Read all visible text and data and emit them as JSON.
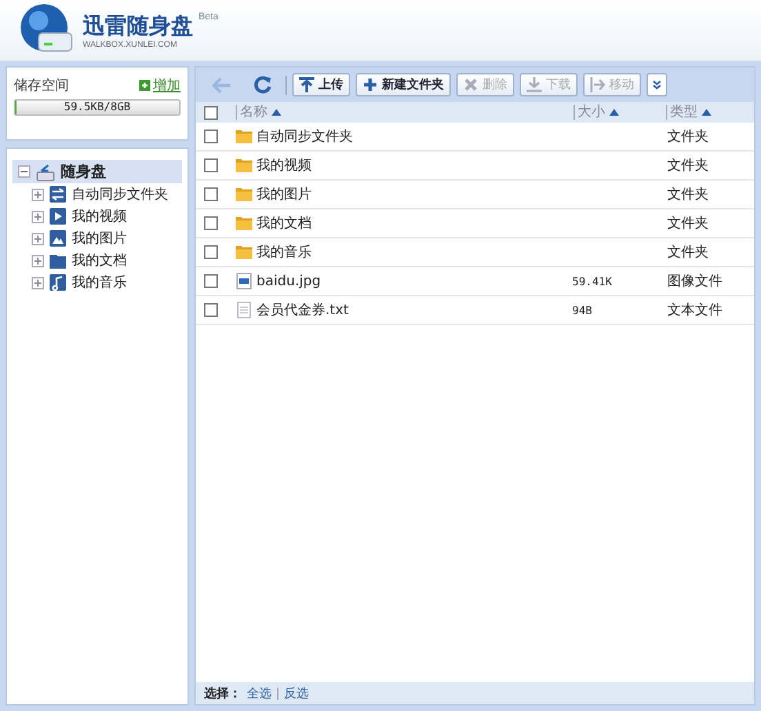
{
  "app": {
    "title": "迅雷随身盘",
    "badge": "Beta",
    "subtitle": "WALKBOX.XUNLEI.COM"
  },
  "storage": {
    "label": "储存空间",
    "add_link": "增加",
    "reading": "59.5KB/8GB",
    "level": 0.01
  },
  "tree": {
    "label": "随身盘",
    "expanded": true,
    "selected": true,
    "children": [
      {
        "label": "自动同步文件夹",
        "kind": "sync",
        "expanded": false,
        "selected": false
      },
      {
        "label": "我的视频",
        "kind": "video",
        "expanded": false,
        "selected": false
      },
      {
        "label": "我的图片",
        "kind": "picture",
        "expanded": false,
        "selected": false
      },
      {
        "label": "我的文档",
        "kind": "document",
        "expanded": false,
        "selected": false
      },
      {
        "label": "我的音乐",
        "kind": "music",
        "expanded": false,
        "selected": false
      }
    ]
  },
  "toolbar": [
    {
      "label": "上传",
      "kind": "upload",
      "disabled": false
    },
    {
      "label": "新建文件夹",
      "kind": "new-folder",
      "disabled": false
    },
    {
      "label": "删除",
      "kind": "delete",
      "disabled": true
    },
    {
      "label": "下载",
      "kind": "download",
      "disabled": true
    },
    {
      "label": "移动",
      "kind": "move",
      "disabled": true
    }
  ],
  "table": {
    "select_all_checked": false,
    "columns": [
      "名称",
      "大小",
      "类型"
    ],
    "rows": [
      {
        "name": "自动同步文件夹",
        "size": "",
        "type": "文件夹",
        "kind": "folder",
        "checked": false
      },
      {
        "name": "我的视频",
        "size": "",
        "type": "文件夹",
        "kind": "folder",
        "checked": false
      },
      {
        "name": "我的图片",
        "size": "",
        "type": "文件夹",
        "kind": "folder",
        "checked": false
      },
      {
        "name": "我的文档",
        "size": "",
        "type": "文件夹",
        "kind": "folder",
        "checked": false
      },
      {
        "name": "我的音乐",
        "size": "",
        "type": "文件夹",
        "kind": "folder",
        "checked": false
      },
      {
        "name": "baidu.jpg",
        "size": "59.41K",
        "type": "图像文件",
        "kind": "image",
        "checked": false
      },
      {
        "name": "会员代金券.txt",
        "size": "94B",
        "type": "文本文件",
        "kind": "text",
        "checked": false
      }
    ]
  },
  "footer": {
    "label": "选择：",
    "links": [
      "全选",
      "反选"
    ]
  }
}
